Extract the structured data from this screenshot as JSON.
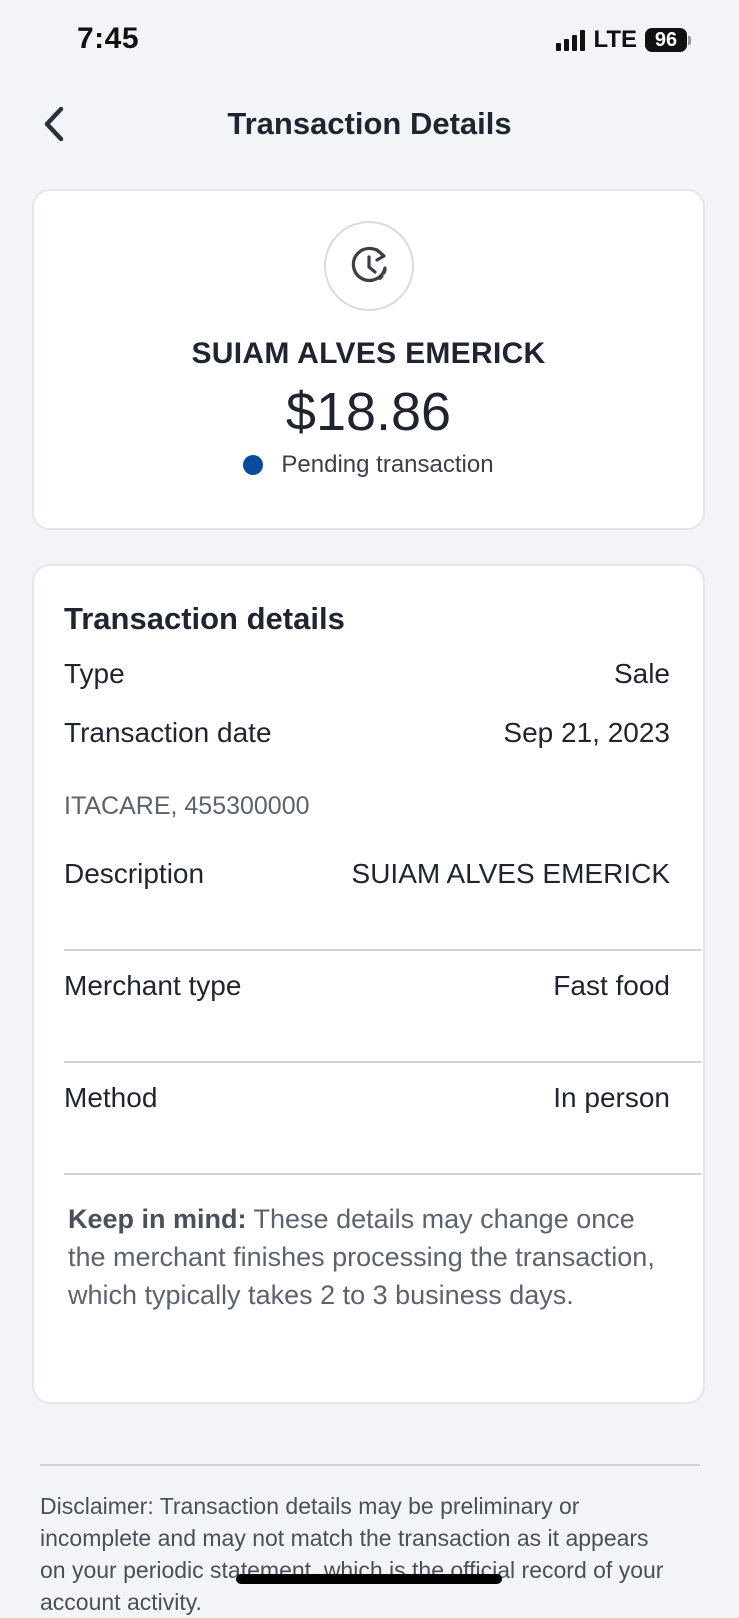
{
  "status_bar": {
    "time": "7:45",
    "network": "LTE",
    "battery": "96"
  },
  "header": {
    "title": "Transaction Details",
    "back_icon": "chevron-left-icon"
  },
  "summary": {
    "status_icon": "clock-pending-icon",
    "merchant": "SUIAM ALVES EMERICK",
    "amount": "$18.86",
    "status_label": "Pending transaction",
    "status_color": "#0b4a9c"
  },
  "details": {
    "title": "Transaction details",
    "type_label": "Type",
    "type_value": "Sale",
    "date_label": "Transaction date",
    "date_value": "Sep 21, 2023",
    "location": "ITACARE, 455300000",
    "description_label": "Description",
    "description_value": "SUIAM ALVES EMERICK",
    "merchant_type_label": "Merchant type",
    "merchant_type_value": "Fast food",
    "method_label": "Method",
    "method_value": "In person",
    "note_bold": "Keep in mind:",
    "note_text": " These details may change once the merchant finishes processing the transaction, which typically takes 2 to 3 business days."
  },
  "disclaimer": "Disclaimer: Transaction details may be preliminary or incomplete and may not match the transaction as it appears on your periodic statement, which is the official record of your account activity."
}
